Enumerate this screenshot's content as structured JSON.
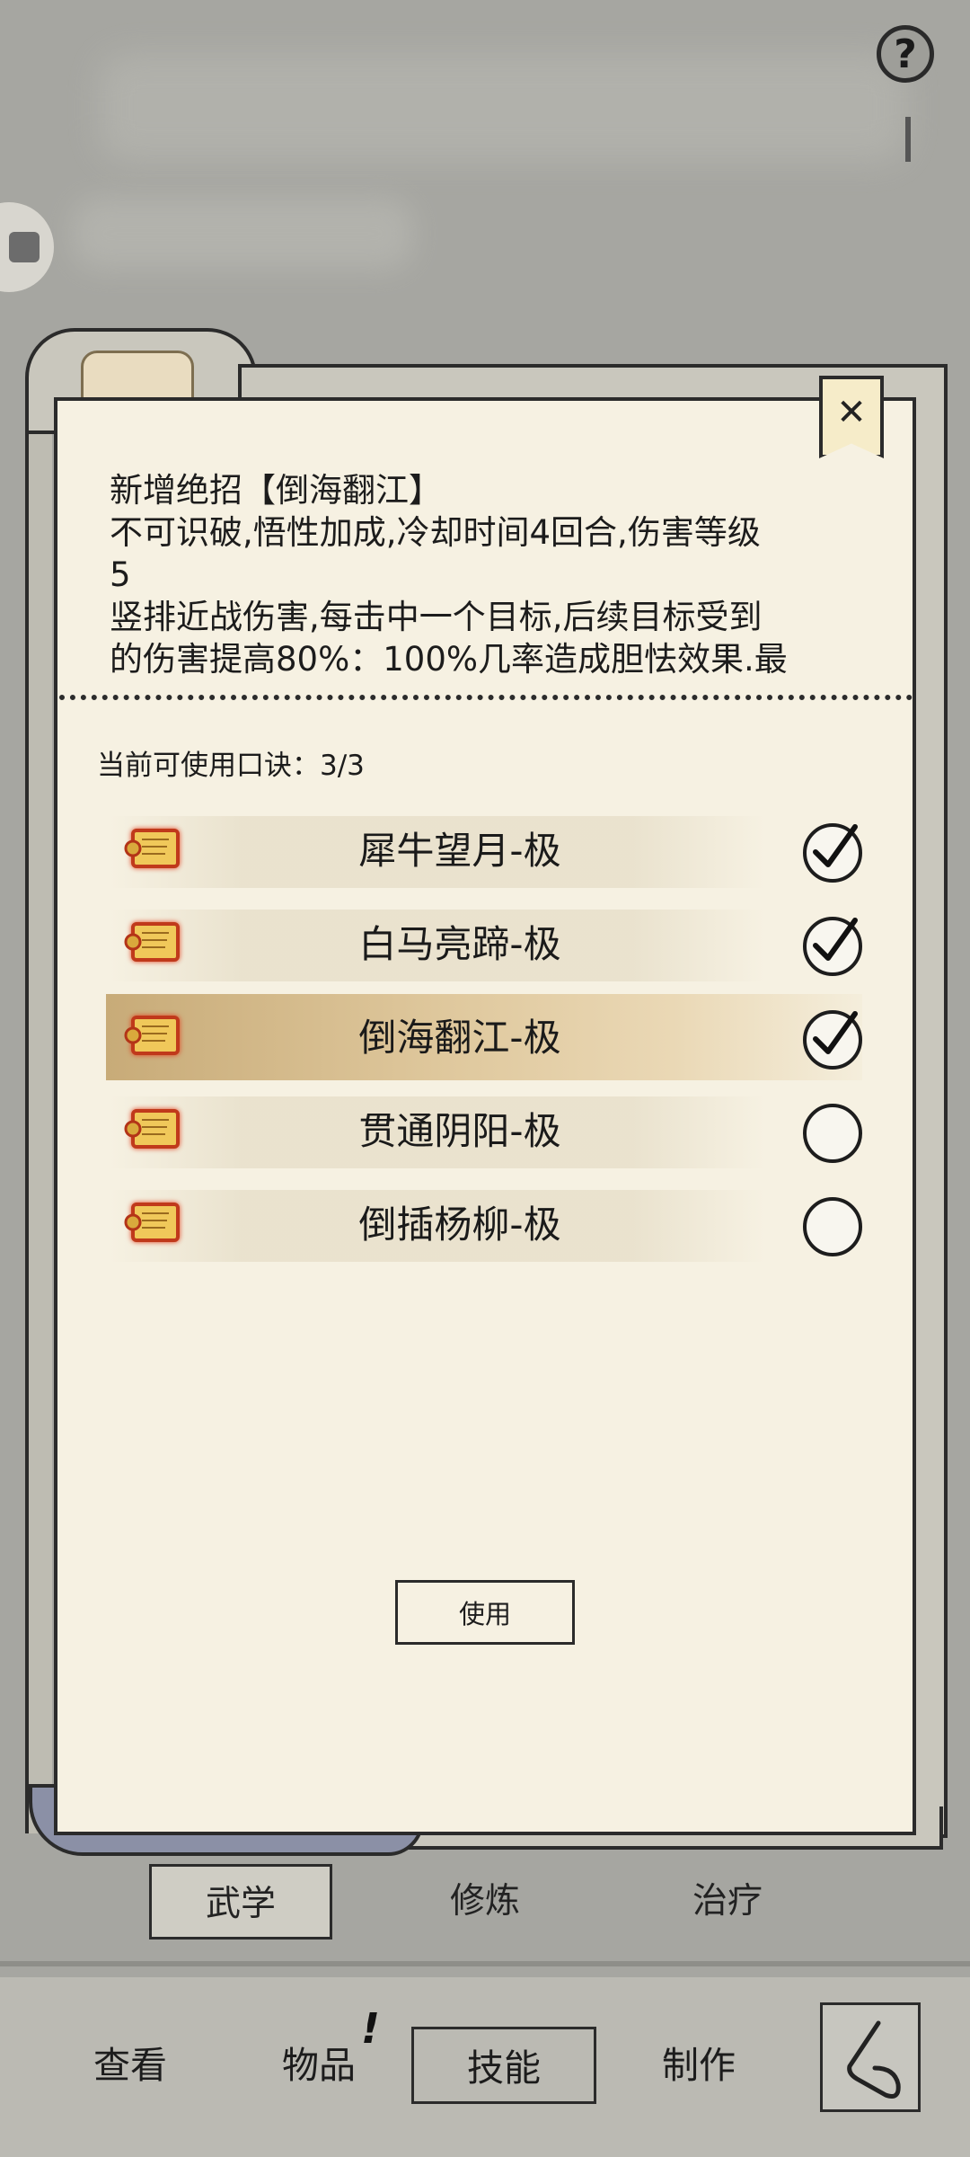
{
  "help_label": "?",
  "panel": {
    "close_label": "✕",
    "description": "新增绝招【倒海翻江】\n不可识破,悟性加成,冷却时间4回合,伤害等级\n5\n竖排近战伤害,每击中一个目标,后续目标受到\n的伤害提高80%：100%几率造成胆怯效果.最",
    "available": "当前可使用口诀：3/3",
    "skills": [
      {
        "name": "犀牛望月-极",
        "checked": true
      },
      {
        "name": "白马亮蹄-极",
        "checked": true
      },
      {
        "name": "倒海翻江-极",
        "checked": true,
        "selected": true
      },
      {
        "name": "贯通阴阳-极",
        "checked": false
      },
      {
        "name": "倒插杨柳-极",
        "checked": false
      }
    ],
    "use_label": "使用"
  },
  "subtabs": [
    "武学",
    "修炼",
    "治疗"
  ],
  "nav": [
    "查看",
    "物品",
    "技能",
    "制作"
  ],
  "nav_badge": "!",
  "colors": {
    "paper": "#f6f1e2",
    "selected_band": "#d6b988",
    "background": "#a6a6a1"
  }
}
